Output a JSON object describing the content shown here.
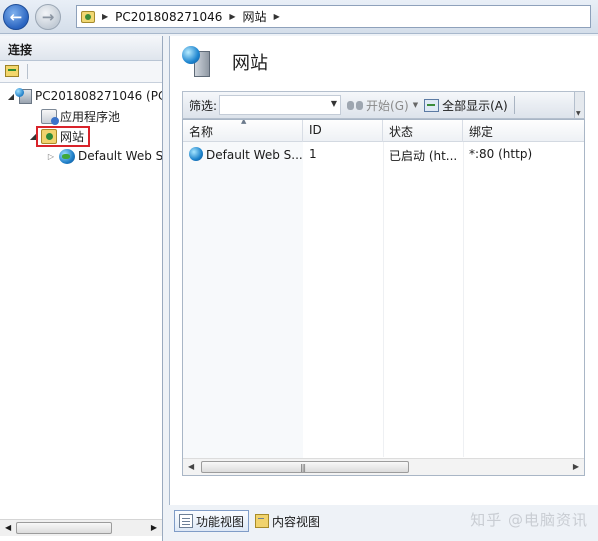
{
  "address_bar": {
    "crumbs": [
      "PC201808271046",
      "网站"
    ]
  },
  "connections": {
    "title": "连接",
    "tree": {
      "server": "PC201808271046 (PC",
      "app_pools": "应用程序池",
      "sites": "网站",
      "default_site": "Default Web S"
    }
  },
  "main": {
    "title": "网站",
    "filter": {
      "label": "筛选:",
      "value": "",
      "start_label": "开始(G)",
      "show_all_label": "全部显示(A)"
    },
    "table": {
      "columns": [
        "名称",
        "ID",
        "状态",
        "绑定"
      ],
      "rows": [
        {
          "name": "Default Web S...",
          "id": "1",
          "status": "已启动 (ht...",
          "binding": "*:80 (http)"
        }
      ]
    }
  },
  "view_tabs": {
    "features": "功能视图",
    "content": "内容视图"
  },
  "watermark": "知乎 @电脑资讯"
}
